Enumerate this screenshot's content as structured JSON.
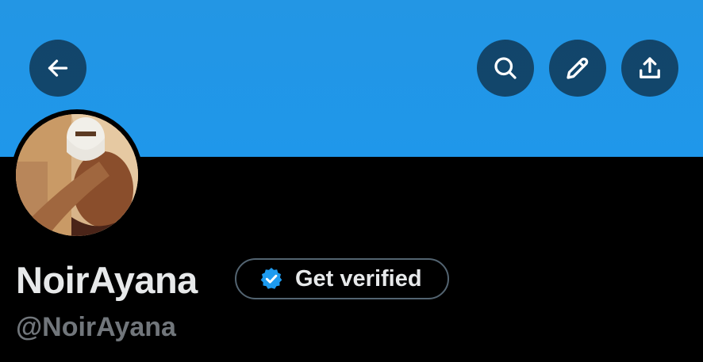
{
  "header": {
    "banner_color": "#1f97ea",
    "buttons": {
      "back_icon": "arrow-left-icon",
      "search_icon": "search-icon",
      "edit_icon": "pencil-icon",
      "share_icon": "share-upload-icon"
    }
  },
  "profile": {
    "display_name": "NoirAyana",
    "handle": "@NoirAyana",
    "verify_button": {
      "label": "Get verified",
      "badge_icon": "verified-badge-icon",
      "badge_color": "#1d9bf0"
    }
  }
}
